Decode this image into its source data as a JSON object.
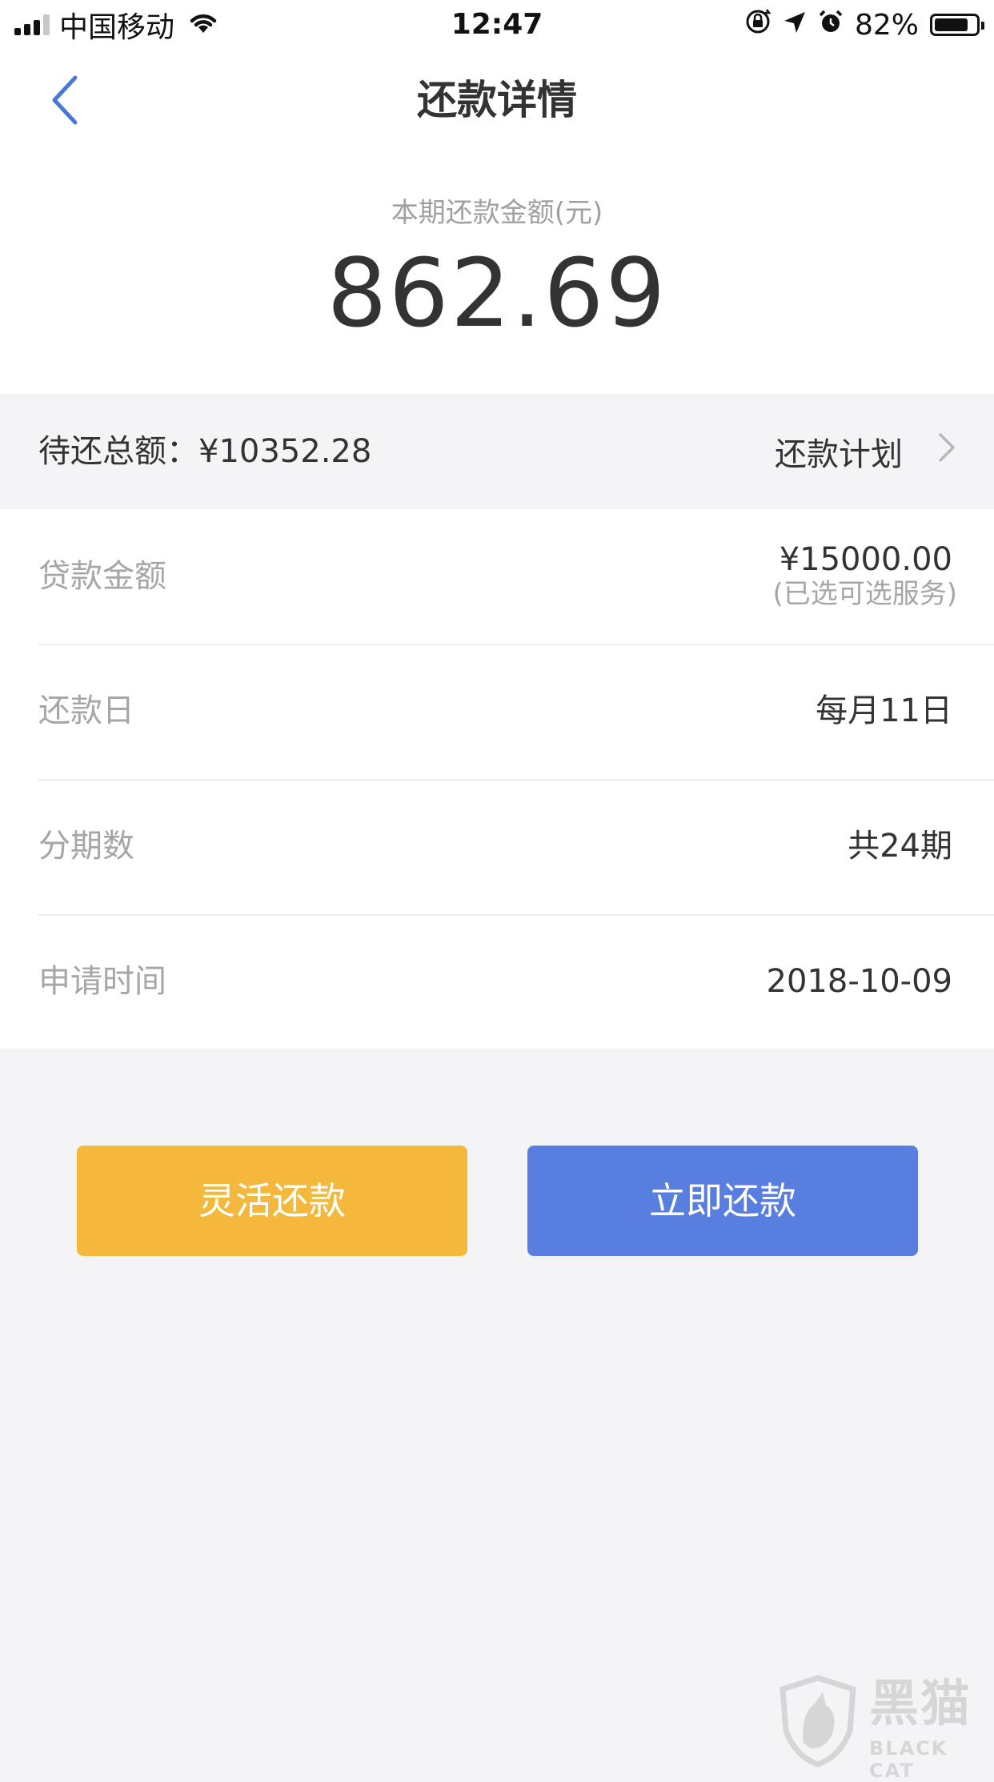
{
  "status_bar": {
    "carrier": "中国移动",
    "time": "12:47",
    "battery": "82%",
    "battery_level": 0.82
  },
  "nav": {
    "title": "还款详情",
    "back_icon": "chevron-left-icon"
  },
  "amount": {
    "label": "本期还款金额(元)",
    "value": "862.69"
  },
  "summary": {
    "pending_total": "待还总额：¥10352.28",
    "plan_link": "还款计划"
  },
  "details": [
    {
      "label": "贷款金额",
      "value": "¥15000.00",
      "note": "(已选可选服务)"
    },
    {
      "label": "还款日",
      "value": "每月11日"
    },
    {
      "label": "分期数",
      "value": "共24期"
    },
    {
      "label": "申请时间",
      "value": "2018-10-09"
    }
  ],
  "buttons": {
    "flexible": "灵活还款",
    "pay_now": "立即还款"
  },
  "colors": {
    "accent_blue": "#587ee0",
    "accent_yellow": "#f4b83d",
    "back_blue": "#4a78d6"
  },
  "watermark": {
    "title": "黑猫",
    "subtitle": "BLACK CAT"
  }
}
